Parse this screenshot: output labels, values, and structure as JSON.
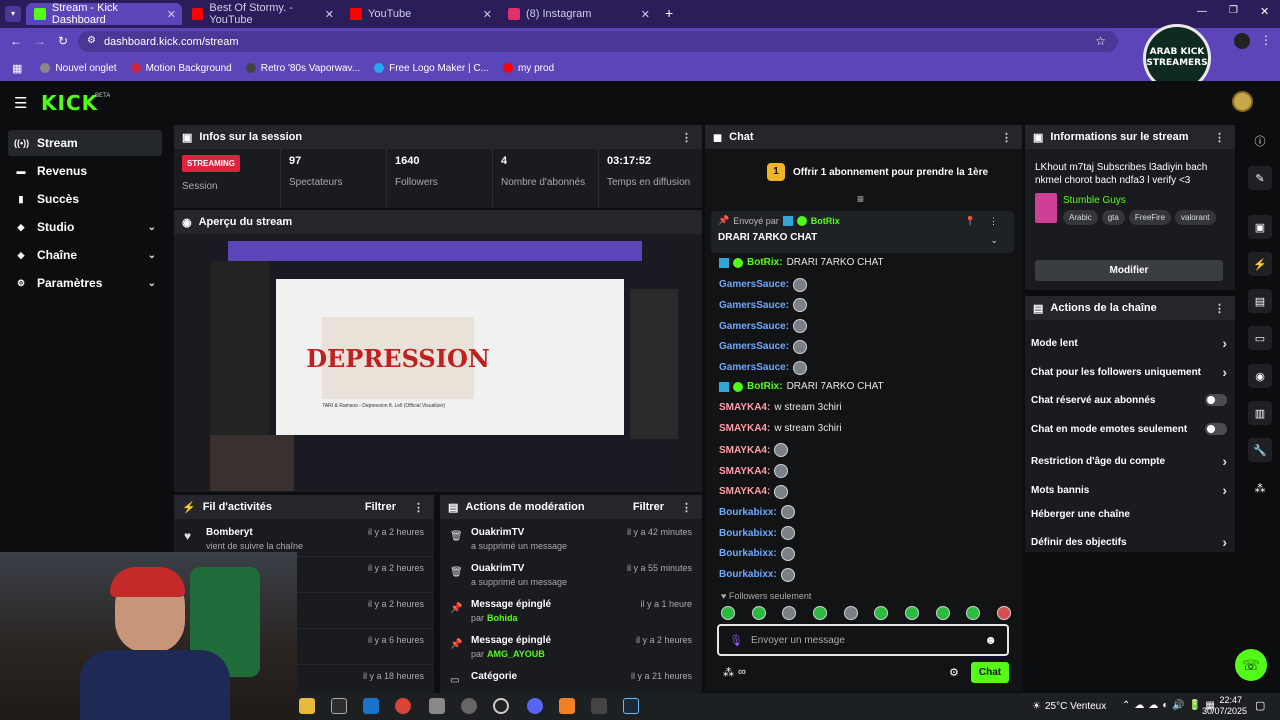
{
  "browser": {
    "tabs": [
      {
        "label": "Stream - Kick Dashboard",
        "active": true,
        "color": "#53fc18"
      },
      {
        "label": "Best Of Stormy. - YouTube",
        "active": false,
        "color": "#ff0000"
      },
      {
        "label": "YouTube",
        "active": false,
        "color": "#ff0000"
      },
      {
        "label": "(8) Instagram",
        "active": false,
        "color": "#e1306c"
      }
    ],
    "url": "dashboard.kick.com/stream",
    "bookmarks": [
      {
        "label": "Nouvel onglet",
        "color": "#888888"
      },
      {
        "label": "Motion Background",
        "color": "#cc2244"
      },
      {
        "label": "Retro '80s Vaporwav...",
        "color": "#444444"
      },
      {
        "label": "Free Logo Maker | C...",
        "color": "#22aaee"
      },
      {
        "label": "my prod",
        "color": "#ff0000"
      }
    ],
    "logo_text": "ARAB KICK STREAMERS"
  },
  "kick": {
    "logo": "KICK",
    "beta": "BETA"
  },
  "sidebar": {
    "items": [
      {
        "label": "Stream",
        "icon": "stream-icon",
        "active": true,
        "chev": false
      },
      {
        "label": "Revenus",
        "icon": "revenue-icon",
        "active": false,
        "chev": false
      },
      {
        "label": "Succès",
        "icon": "achievements-icon",
        "active": false,
        "chev": false
      },
      {
        "label": "Studio",
        "icon": "studio-icon",
        "active": false,
        "chev": true
      },
      {
        "label": "Chaîne",
        "icon": "channel-icon",
        "active": false,
        "chev": true
      },
      {
        "label": "Paramètres",
        "icon": "settings-icon",
        "active": false,
        "chev": true
      }
    ]
  },
  "session": {
    "title": "Infos sur la session",
    "status": "STREAMING",
    "status_label": "Session",
    "stats": [
      {
        "value": "97",
        "label": "Spectateurs"
      },
      {
        "value": "1640",
        "label": "Followers"
      },
      {
        "value": "4",
        "label": "Nombre d'abonnés"
      },
      {
        "value": "03:17:52",
        "label": "Temps en diffusion"
      }
    ]
  },
  "preview": {
    "title": "Aperçu du stream",
    "video_text": "DEPRESSION",
    "video_title": "7ARI & Ramsoo - Depression ft. Lell (Official Visualizer)"
  },
  "activity": {
    "title": "Fil d'activités",
    "filter": "Filtrer",
    "items": [
      {
        "name": "Bomberyt",
        "sub": "vient de suivre la chaîne",
        "time": "il y a 2 heures"
      },
      {
        "name": "",
        "sub": "",
        "time": "il y a 2 heures"
      },
      {
        "name": "",
        "sub": "",
        "time": "il y a 2 heures"
      },
      {
        "name": "",
        "sub": "",
        "time": "il y a 6 heures"
      },
      {
        "name": "",
        "sub": "",
        "time": "il y a 18 heures"
      }
    ]
  },
  "moderation": {
    "title": "Actions de modération",
    "filter": "Filtrer",
    "items": [
      {
        "title": "OuakrimTV",
        "sub": "a supprimé un message",
        "by": "",
        "time": "il y a 42 minutes",
        "icon": "trash-icon"
      },
      {
        "title": "OuakrimTV",
        "sub": "a supprimé un message",
        "by": "",
        "time": "il y a 55 minutes",
        "icon": "trash-icon"
      },
      {
        "title": "Message épinglé",
        "sub": "par",
        "by": "Bohida",
        "time": "il y a 1 heure",
        "icon": "pin-icon"
      },
      {
        "title": "Message épinglé",
        "sub": "par",
        "by": "AMG_AYOUB",
        "time": "il y a 2 heures",
        "icon": "pin-icon"
      },
      {
        "title": "Catégorie",
        "sub": "",
        "by": "",
        "time": "il y a 21 heures",
        "icon": "category-icon"
      }
    ]
  },
  "chat": {
    "title": "Chat",
    "sub_banner": "Offrir 1 abonnement pour prendre la 1ère",
    "sub_count": "1",
    "pinned_by_label": "Envoyé par",
    "pinned_by": "BotRix",
    "pinned_message": "DRARI 7ARKO CHAT",
    "messages": [
      {
        "user": "BotRix",
        "text": "DRARI 7ARKO CHAT",
        "color": "#e6e6e6",
        "emote": false
      },
      {
        "user": "GamersSauce",
        "text": "",
        "color": "#6ea8ff",
        "emote": true
      },
      {
        "user": "GamersSauce",
        "text": "",
        "color": "#6ea8ff",
        "emote": true
      },
      {
        "user": "GamersSauce",
        "text": "",
        "color": "#6ea8ff",
        "emote": true
      },
      {
        "user": "GamersSauce",
        "text": "",
        "color": "#6ea8ff",
        "emote": true
      },
      {
        "user": "GamersSauce",
        "text": "",
        "color": "#6ea8ff",
        "emote": true
      },
      {
        "user": "BotRix",
        "text": "DRARI 7ARKO CHAT",
        "color": "#e6e6e6",
        "emote": false
      },
      {
        "user": "SMAYKA4",
        "text": "w stream 3chiri",
        "color": "#ff9ea8",
        "emote": false
      },
      {
        "user": "SMAYKA4",
        "text": "w stream 3chiri",
        "color": "#ff9ea8",
        "emote": false
      },
      {
        "user": "SMAYKA4",
        "text": "",
        "color": "#ff9ea8",
        "emote": true
      },
      {
        "user": "SMAYKA4",
        "text": "",
        "color": "#ff9ea8",
        "emote": true
      },
      {
        "user": "SMAYKA4",
        "text": "",
        "color": "#ff9ea8",
        "emote": true
      },
      {
        "user": "Bourkabixx",
        "text": "",
        "color": "#6ea8ff",
        "emote": true
      },
      {
        "user": "Bourkabixx",
        "text": "",
        "color": "#6ea8ff",
        "emote": true
      },
      {
        "user": "Bourkabixx",
        "text": "",
        "color": "#6ea8ff",
        "emote": true
      },
      {
        "user": "Bourkabixx",
        "text": "",
        "color": "#6ea8ff",
        "emote": true
      }
    ],
    "followers_only": "Followers seulement",
    "input_placeholder": "Envoyer un message",
    "send_label": "Chat"
  },
  "stream_info": {
    "title": "Informations sur le stream",
    "stream_title": "LKhout m7taj Subscribes l3adiyin bach nkmel chorot bach ndfa3 l verify <3",
    "category": "Stumble Guys",
    "tags": [
      "Arabic",
      "gta",
      "FreeFire",
      "valorant"
    ],
    "edit_label": "Modifier"
  },
  "channel_actions": {
    "title": "Actions de la chaîne",
    "items": [
      {
        "label": "Mode lent",
        "kind": "chev"
      },
      {
        "label": "Chat pour les followers uniquement",
        "kind": "chev"
      },
      {
        "label": "Chat réservé aux abonnés",
        "kind": "toggle"
      },
      {
        "label": "Chat en mode emotes seulement",
        "kind": "toggle"
      },
      {
        "label": "Restriction d'âge du compte",
        "kind": "chev"
      },
      {
        "label": "Mots bannis",
        "kind": "chev"
      },
      {
        "label": "Héberger une chaîne",
        "kind": "none"
      },
      {
        "label": "Définir des objectifs",
        "kind": "chev"
      }
    ]
  },
  "taskbar": {
    "weather": "25°C Venteux",
    "time": "22:47",
    "date": "30/07/2025"
  }
}
